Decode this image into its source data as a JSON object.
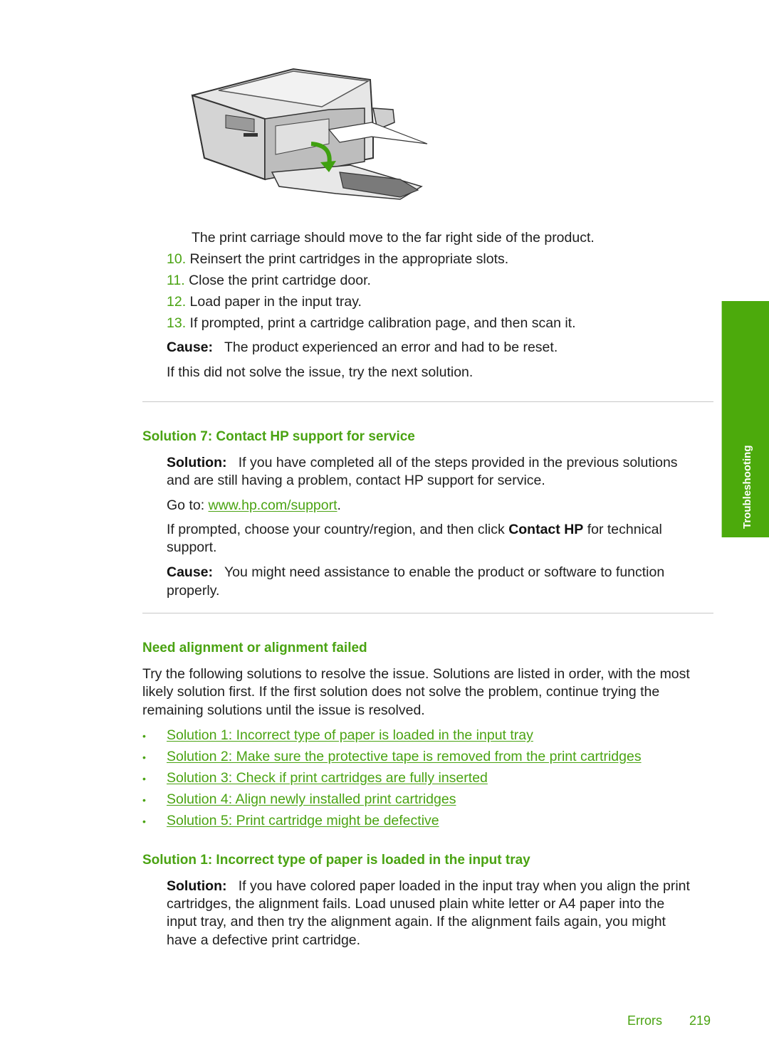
{
  "figure": {
    "alt": "printer-with-print-cartridge-door-open-illustration"
  },
  "steps": {
    "carriage_note": "The print carriage should move to the far right side of the product.",
    "items": [
      {
        "number": "10.",
        "text": "Reinsert the print cartridges in the appropriate slots."
      },
      {
        "number": "11.",
        "text": "Close the print cartridge door."
      },
      {
        "number": "12.",
        "text": "Load paper in the input tray."
      },
      {
        "number": "13.",
        "text": "If prompted, print a cartridge calibration page, and then scan it."
      }
    ]
  },
  "solution6_cause": {
    "label": "Cause:",
    "text": "The product experienced an error and had to be reset."
  },
  "next_solution_note": "If this did not solve the issue, try the next solution.",
  "solution7": {
    "heading": "Solution 7: Contact HP support for service",
    "solution_label": "Solution:",
    "solution_text_line1": "If you have completed all of the steps provided in the previous solutions",
    "solution_text_line2": "and are still having a problem, contact HP support for service.",
    "goto_prefix": "Go to: ",
    "goto_link": "www.hp.com/support",
    "goto_suffix": ".",
    "prompt_prefix": "If prompted, choose your country/region, and then click ",
    "prompt_bold": "Contact HP",
    "prompt_suffix": " for technical",
    "prompt_line2": "support.",
    "cause_label": "Cause:",
    "cause_text_line1": "You might need assistance to enable the product or software to function",
    "cause_text_line2": "properly."
  },
  "alignment": {
    "heading": "Need alignment or alignment failed",
    "intro_line1": "Try the following solutions to resolve the issue. Solutions are listed in order, with the most",
    "intro_line2": "likely solution first. If the first solution does not solve the problem, continue trying the",
    "intro_line3": "remaining solutions until the issue is resolved.",
    "bullet_char": "•",
    "links": [
      "Solution 1: Incorrect type of paper is loaded in the input tray",
      "Solution 2: Make sure the protective tape is removed from the print cartridges",
      "Solution 3: Check if print cartridges are fully inserted",
      "Solution 4: Align newly installed print cartridges",
      "Solution 5: Print cartridge might be defective"
    ]
  },
  "solution1": {
    "heading": "Solution 1: Incorrect type of paper is loaded in the input tray",
    "solution_label": "Solution:",
    "line1": "If you have colored paper loaded in the input tray when you align the print",
    "line2": "cartridges, the alignment fails. Load unused plain white letter or A4 paper into the",
    "line3": "input tray, and then try the alignment again. If the alignment fails again, you might",
    "line4": "have a defective print cartridge."
  },
  "side_tab": {
    "label": "Troubleshooting",
    "color": "#4caa0c"
  },
  "footer": {
    "section": "Errors",
    "page_number": "219"
  },
  "colors": {
    "accent": "#4aa312",
    "text": "#1f1f1f",
    "rule": "#c8c8c8"
  }
}
